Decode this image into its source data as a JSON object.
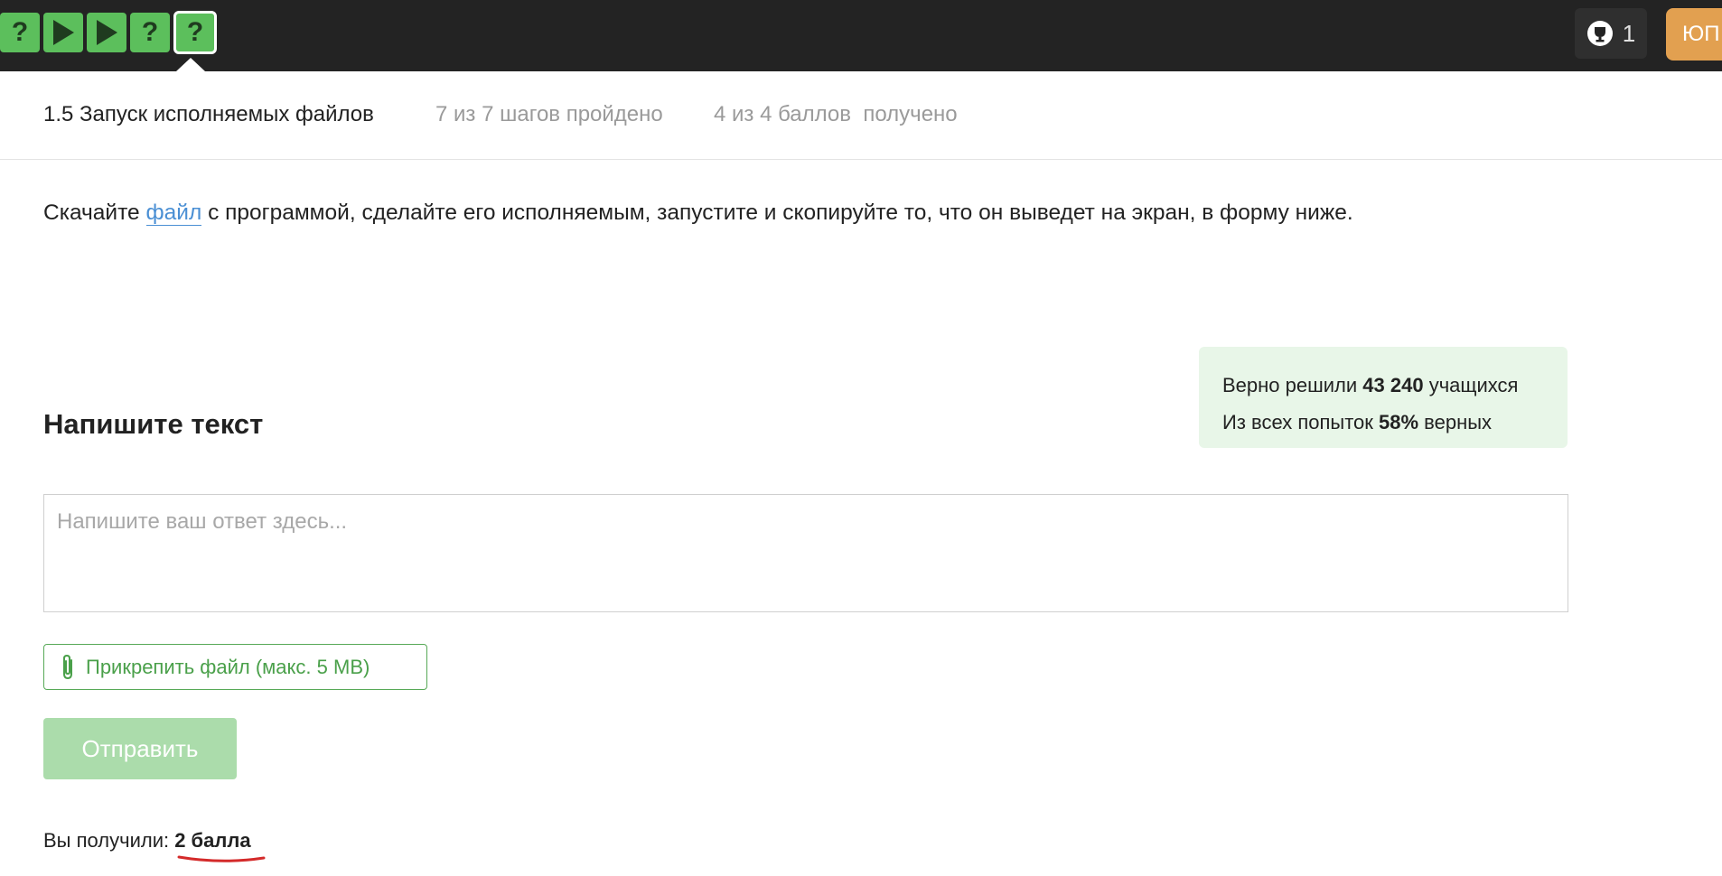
{
  "topbar": {
    "steps": [
      {
        "icon": "question-icon",
        "symbol": "?"
      },
      {
        "icon": "play-icon"
      },
      {
        "icon": "play-icon"
      },
      {
        "icon": "question-icon",
        "symbol": "?"
      },
      {
        "icon": "question-icon",
        "symbol": "?",
        "active": true
      }
    ],
    "award_count": "1",
    "avatar_initials": "ЮП",
    "colors": {
      "bar": "#232323",
      "step": "#5cbf5c",
      "avatar": "#e2a050"
    }
  },
  "lesson": {
    "title": "1.5 Запуск исполняемых файлов",
    "steps_progress": "7 из 7 шагов пройдено",
    "points_progress": "4 из 4 баллов  получено"
  },
  "task": {
    "before": "Скачайте ",
    "link": "файл",
    "after": " с программой, сделайте его исполняемым, запустите и скопируйте то, что он выведет на экран, в форму ниже."
  },
  "stats": {
    "solved_prefix": "Верно решили ",
    "solved_count": "43 240",
    "solved_suffix": " учащихся",
    "attempts_prefix": "Из всех попыток ",
    "attempts_percent": "58%",
    "attempts_suffix": " верных"
  },
  "form": {
    "section_title": "Напишите текст",
    "answer_placeholder": "Напишите ваш ответ здесь...",
    "attach_label": "Прикрепить файл (макс. 5 MB)",
    "submit_label": "Отправить"
  },
  "result": {
    "prefix": "Вы получили: ",
    "score": "2 балла"
  }
}
